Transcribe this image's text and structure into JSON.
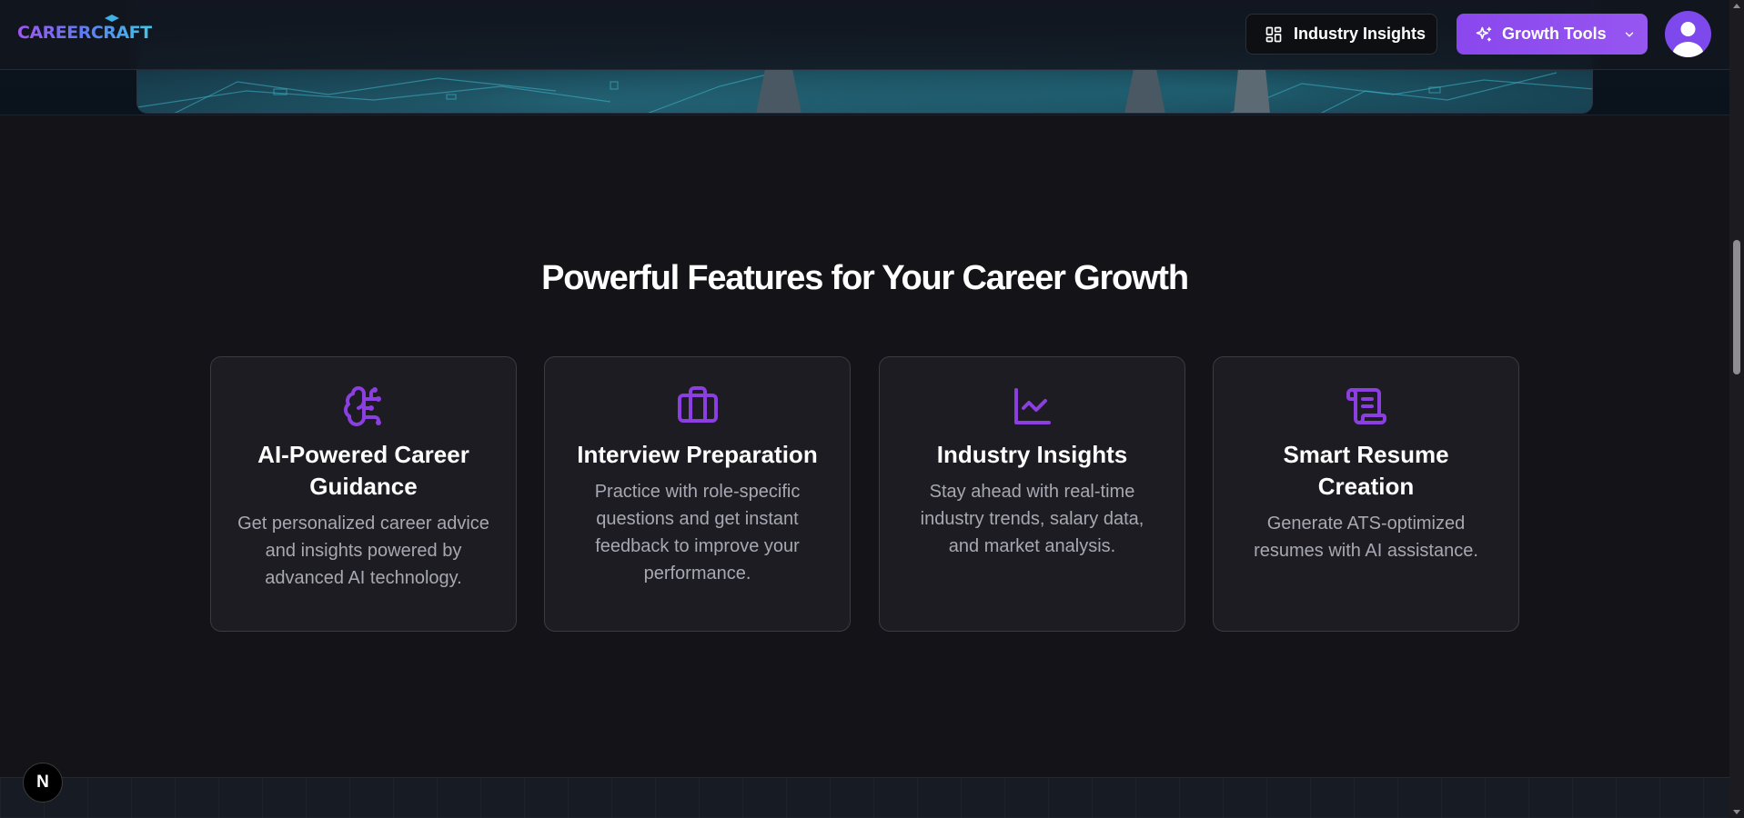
{
  "header": {
    "logo_text": "CAREERCRAFT",
    "industry_insights_label": "Industry Insights",
    "growth_tools_label": "Growth Tools"
  },
  "features": {
    "title": "Powerful Features for Your Career Growth",
    "cards": [
      {
        "icon": "brain-circuit-icon",
        "title": "AI-Powered Career Guidance",
        "description": "Get personalized career advice and insights powered by advanced AI technology."
      },
      {
        "icon": "briefcase-icon",
        "title": "Interview Preparation",
        "description": "Practice with role-specific questions and get instant feedback to improve your performance."
      },
      {
        "icon": "line-chart-icon",
        "title": "Industry Insights",
        "description": "Stay ahead with real-time industry trends, salary data, and market analysis."
      },
      {
        "icon": "scroll-text-icon",
        "title": "Smart Resume Creation",
        "description": "Generate ATS-optimized resumes with AI assistance."
      }
    ]
  },
  "badge": {
    "letter": "N"
  },
  "colors": {
    "accent": "#8a47ee",
    "icon": "#8b3fe0",
    "background": "#141318",
    "card": "#1c1c22"
  }
}
